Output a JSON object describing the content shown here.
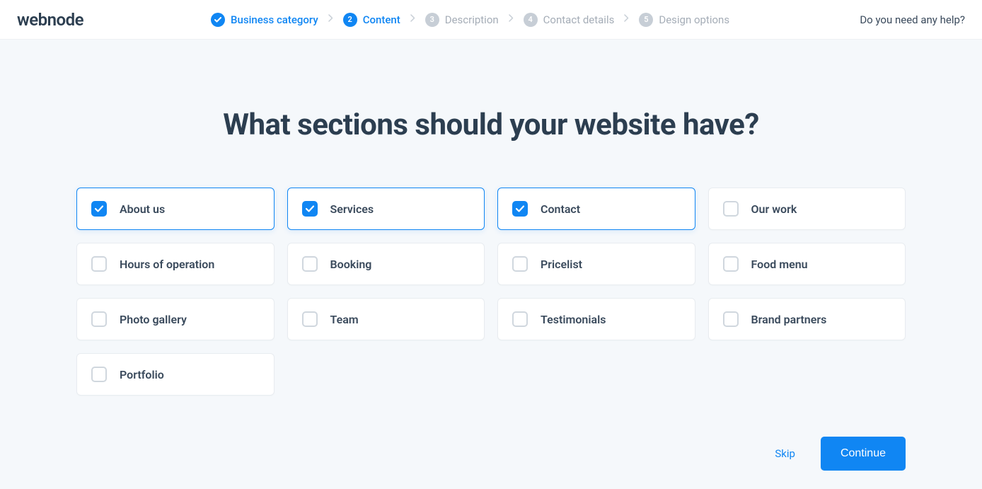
{
  "logo": "webnode",
  "help_text": "Do you need any help?",
  "steps": [
    {
      "num": "",
      "label": "Business category",
      "state": "done"
    },
    {
      "num": "2",
      "label": "Content",
      "state": "active"
    },
    {
      "num": "3",
      "label": "Description",
      "state": "pending"
    },
    {
      "num": "4",
      "label": "Contact details",
      "state": "pending"
    },
    {
      "num": "5",
      "label": "Design options",
      "state": "pending"
    }
  ],
  "title": "What sections should your website have?",
  "options": [
    {
      "label": "About us",
      "selected": true
    },
    {
      "label": "Services",
      "selected": true
    },
    {
      "label": "Contact",
      "selected": true
    },
    {
      "label": "Our work",
      "selected": false
    },
    {
      "label": "Hours of operation",
      "selected": false
    },
    {
      "label": "Booking",
      "selected": false
    },
    {
      "label": "Pricelist",
      "selected": false
    },
    {
      "label": "Food menu",
      "selected": false
    },
    {
      "label": "Photo gallery",
      "selected": false
    },
    {
      "label": "Team",
      "selected": false
    },
    {
      "label": "Testimonials",
      "selected": false
    },
    {
      "label": "Brand partners",
      "selected": false
    },
    {
      "label": "Portfolio",
      "selected": false
    }
  ],
  "footer": {
    "skip": "Skip",
    "continue": "Continue"
  }
}
